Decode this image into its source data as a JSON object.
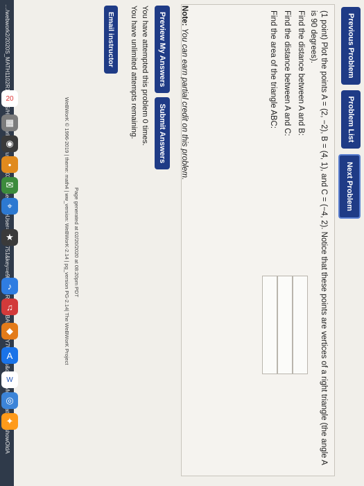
{
  "nav": {
    "previous": "Previous Problem",
    "list": "Problem List",
    "next": "Next Problem"
  },
  "problem": {
    "points": "(1 point)",
    "statement": "Plot the points A = (2, −2), B = (4, 1), and C = (−4, 2). Notice that these points are vertices of a right triangle (the angle A is 90 degrees).",
    "q1": "Find the distance between A and B:",
    "q2": "Find the distance between A and C:",
    "q3": "Find the area of the triangle ABC:"
  },
  "note": {
    "label": "Note:",
    "text": "You can earn partial credit on this problem."
  },
  "actions": {
    "preview": "Preview My Answers",
    "submit": "Submit Answers"
  },
  "status": {
    "attempted": "You have attempted this problem 0 times.",
    "remaining": "You have unlimited attempts remaining."
  },
  "email": "Email instructor",
  "footer": {
    "generated": "Page generated at 02/20/2020 at 08:20pm PDT",
    "copyright": "WeBWorK © 1996-2019 | theme: math4 | ww_version: WeBWorK-2.14 | pg_version PG-2.14| The WeBWorK Project"
  },
  "urlbar": "…/webwork2/2020S_MATH1102R10_BCS/Homework_4/6/?user=10033751&effectiveUser=10033751&key=e9lDMVGRHYtzHBAl2HmCY7UDDhlu&displayMode=MathJax&showOldA"
}
